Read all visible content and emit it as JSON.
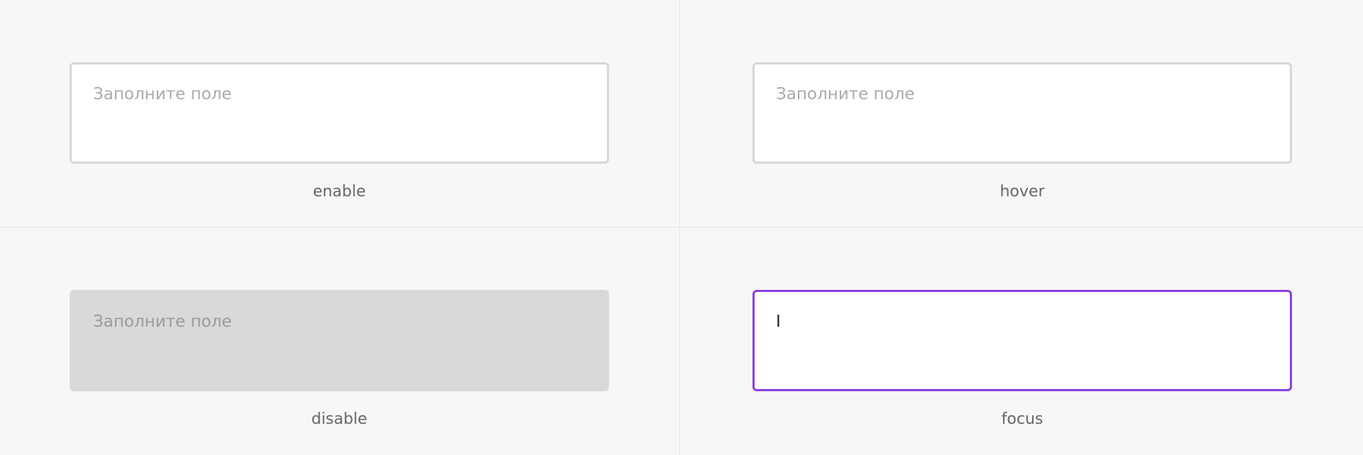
{
  "states": {
    "enable": {
      "placeholder": "Заполните поле",
      "value": "",
      "caption": "enable"
    },
    "hover": {
      "placeholder": "Заполните поле",
      "value": "",
      "caption": "hover"
    },
    "disable": {
      "placeholder": "Заполните поле",
      "value": "",
      "caption": "disable"
    },
    "focus": {
      "placeholder": "",
      "value": "I",
      "caption": "focus"
    }
  },
  "colors": {
    "background": "#f7f7f7",
    "border_default": "#d7d7d7",
    "disabled_fill": "#d9d9d9",
    "focus_border": "#8b3fe0",
    "placeholder_text": "#aaaaaa",
    "caption_text": "#666666"
  }
}
